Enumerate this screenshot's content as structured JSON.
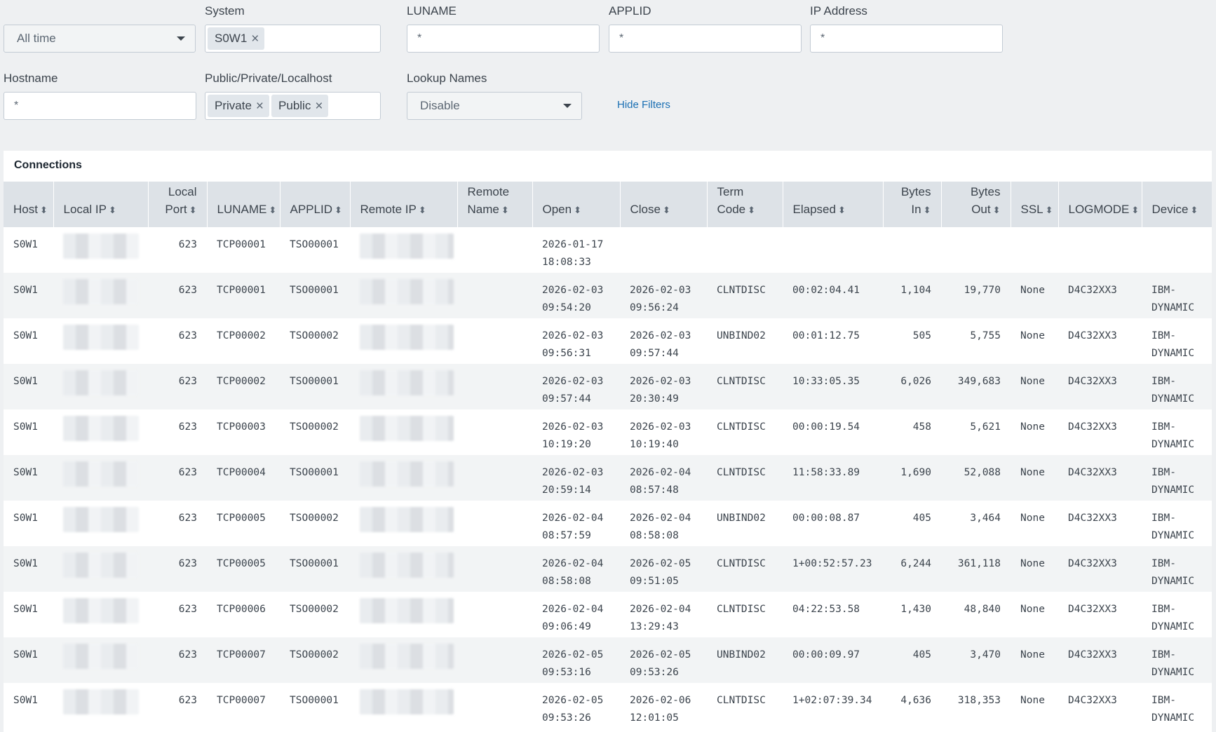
{
  "filters": {
    "time_range": {
      "value": "All time"
    },
    "system": {
      "label": "System",
      "chips": [
        "S0W1"
      ]
    },
    "luname": {
      "label": "LUNAME",
      "value": "*"
    },
    "applid": {
      "label": "APPLID",
      "value": "*"
    },
    "ip_address": {
      "label": "IP Address",
      "value": "*"
    },
    "hostname": {
      "label": "Hostname",
      "value": "*"
    },
    "scope": {
      "label": "Public/Private/Localhost",
      "chips": [
        "Private",
        "Public"
      ]
    },
    "lookup_names": {
      "label": "Lookup Names",
      "value": "Disable"
    },
    "hide_filters_label": "Hide Filters"
  },
  "panel": {
    "title": "Connections",
    "columns": [
      "Host",
      "Local IP",
      "Local Port",
      "LUNAME",
      "APPLID",
      "Remote IP",
      "Remote Name",
      "Open",
      "Close",
      "Term Code",
      "Elapsed",
      "Bytes In",
      "Bytes Out",
      "SSL",
      "LOGMODE",
      "Device"
    ],
    "rows": [
      [
        "S0W1",
        "",
        "623",
        "TCP00001",
        "TSO00001",
        "",
        "",
        "2026-01-17\n18:08:33",
        "",
        "",
        "",
        "",
        "",
        "",
        "",
        ""
      ],
      [
        "S0W1",
        "",
        "623",
        "TCP00001",
        "TSO00001",
        "",
        "",
        "2026-02-03\n09:54:20",
        "2026-02-03\n09:56:24",
        "CLNTDISC",
        "00:02:04.41",
        "1,104",
        "19,770",
        "None",
        "D4C32XX3",
        "IBM-\nDYNAMIC"
      ],
      [
        "S0W1",
        "",
        "623",
        "TCP00002",
        "TSO00002",
        "",
        "",
        "2026-02-03\n09:56:31",
        "2026-02-03\n09:57:44",
        "UNBIND02",
        "00:01:12.75",
        "505",
        "5,755",
        "None",
        "D4C32XX3",
        "IBM-\nDYNAMIC"
      ],
      [
        "S0W1",
        "",
        "623",
        "TCP00002",
        "TSO00001",
        "",
        "",
        "2026-02-03\n09:57:44",
        "2026-02-03\n20:30:49",
        "CLNTDISC",
        "10:33:05.35",
        "6,026",
        "349,683",
        "None",
        "D4C32XX3",
        "IBM-\nDYNAMIC"
      ],
      [
        "S0W1",
        "",
        "623",
        "TCP00003",
        "TSO00002",
        "",
        "",
        "2026-02-03\n10:19:20",
        "2026-02-03\n10:19:40",
        "CLNTDISC",
        "00:00:19.54",
        "458",
        "5,621",
        "None",
        "D4C32XX3",
        "IBM-\nDYNAMIC"
      ],
      [
        "S0W1",
        "",
        "623",
        "TCP00004",
        "TSO00001",
        "",
        "",
        "2026-02-03\n20:59:14",
        "2026-02-04\n08:57:48",
        "CLNTDISC",
        "11:58:33.89",
        "1,690",
        "52,088",
        "None",
        "D4C32XX3",
        "IBM-\nDYNAMIC"
      ],
      [
        "S0W1",
        "",
        "623",
        "TCP00005",
        "TSO00002",
        "",
        "",
        "2026-02-04\n08:57:59",
        "2026-02-04\n08:58:08",
        "UNBIND02",
        "00:00:08.87",
        "405",
        "3,464",
        "None",
        "D4C32XX3",
        "IBM-\nDYNAMIC"
      ],
      [
        "S0W1",
        "",
        "623",
        "TCP00005",
        "TSO00001",
        "",
        "",
        "2026-02-04\n08:58:08",
        "2026-02-05\n09:51:05",
        "CLNTDISC",
        "1+00:52:57.23",
        "6,244",
        "361,118",
        "None",
        "D4C32XX3",
        "IBM-\nDYNAMIC"
      ],
      [
        "S0W1",
        "",
        "623",
        "TCP00006",
        "TSO00002",
        "",
        "",
        "2026-02-04\n09:06:49",
        "2026-02-04\n13:29:43",
        "CLNTDISC",
        "04:22:53.58",
        "1,430",
        "48,840",
        "None",
        "D4C32XX3",
        "IBM-\nDYNAMIC"
      ],
      [
        "S0W1",
        "",
        "623",
        "TCP00007",
        "TSO00002",
        "",
        "",
        "2026-02-05\n09:53:16",
        "2026-02-05\n09:53:26",
        "UNBIND02",
        "00:00:09.97",
        "405",
        "3,470",
        "None",
        "D4C32XX3",
        "IBM-\nDYNAMIC"
      ],
      [
        "S0W1",
        "",
        "623",
        "TCP00007",
        "TSO00001",
        "",
        "",
        "2026-02-05\n09:53:26",
        "2026-02-06\n12:01:05",
        "CLNTDISC",
        "1+02:07:39.34",
        "4,636",
        "318,353",
        "None",
        "D4C32XX3",
        "IBM-\nDYNAMIC"
      ]
    ]
  }
}
